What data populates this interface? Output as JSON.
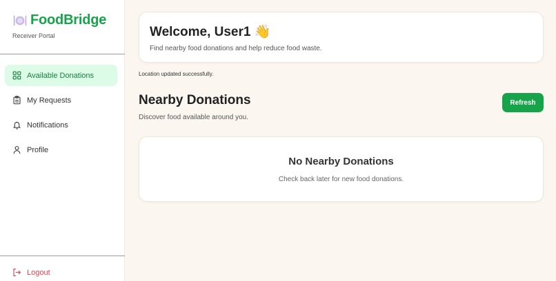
{
  "brand": {
    "name": "FoodBridge",
    "subtitle": "Receiver Portal",
    "icon": "plate-cutlery-icon",
    "accent_color": "#16a34a"
  },
  "sidebar": {
    "items": [
      {
        "label": "Available Donations",
        "icon": "grid-icon",
        "active": true
      },
      {
        "label": "My Requests",
        "icon": "clipboard-icon",
        "active": false
      },
      {
        "label": "Notifications",
        "icon": "bell-icon",
        "active": false
      },
      {
        "label": "Profile",
        "icon": "user-icon",
        "active": false
      }
    ],
    "logout_label": "Logout",
    "logout_color": "#e0454a"
  },
  "welcome": {
    "title": "Welcome, User1 👋",
    "subtitle": "Find nearby food donations and help reduce food waste."
  },
  "status_message": "Location updated successfully.",
  "donations": {
    "title": "Nearby Donations",
    "subtitle": "Discover food available around you.",
    "refresh_label": "Refresh",
    "empty_title": "No Nearby Donations",
    "empty_subtitle": "Check back later for new food donations."
  }
}
